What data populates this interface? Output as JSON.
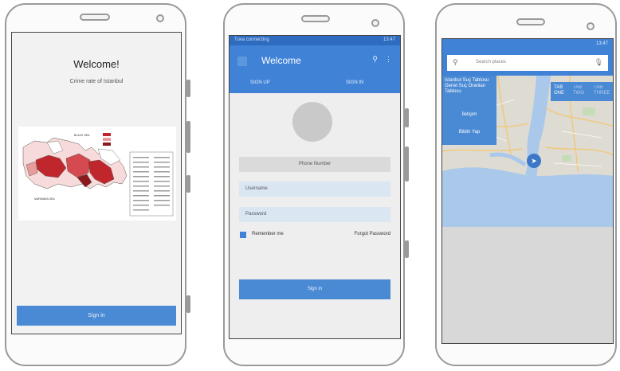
{
  "phone1": {
    "title": "Welcome!",
    "subtitle": "Crime rate of Istanbul",
    "map_labels": {
      "north": "BLACK SEA",
      "south": "MARMARA SEA"
    },
    "button_label": "Sign in"
  },
  "phone2": {
    "status_left": "Tuva connecting",
    "status_right": "13:47",
    "app_title": "Welcome",
    "tabs": [
      "SIGN UP",
      "SIGN IN"
    ],
    "phone_placeholder": "Phone Number",
    "username_placeholder": "Username",
    "password_placeholder": "Password",
    "remember_label": "Remember me",
    "forgot_label": "Forgot Password",
    "signin_label": "Sign in"
  },
  "phone3": {
    "status_right": "13:47",
    "search_placeholder": "Search places",
    "menu": {
      "item1": "Istanbul Suç Tablosu Genel Suç Oranları Tablosu",
      "item2": "İletişim",
      "item3": "Bildiri Yap"
    },
    "tabs": [
      "TAB ONE",
      "TAB TWO",
      "TAB THREE"
    ]
  },
  "colors": {
    "accent": "#3f82d6",
    "button": "#4a89d4",
    "crime_dark": "#c0272d",
    "crime_light": "#e89b9b"
  }
}
